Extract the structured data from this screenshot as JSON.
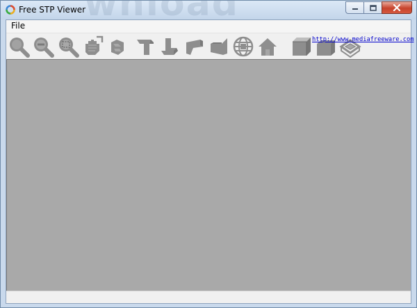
{
  "window": {
    "title": "Free STP Viewer",
    "ghost_text": "wnload"
  },
  "menu": [
    {
      "label": "File"
    }
  ],
  "toolbar": {
    "link_text": "http://www.mediafreeware.com"
  },
  "colors": {
    "viewport_background": "#a9a9a9",
    "icon_gray": "#8e8e8e",
    "link": "#0000cc"
  }
}
